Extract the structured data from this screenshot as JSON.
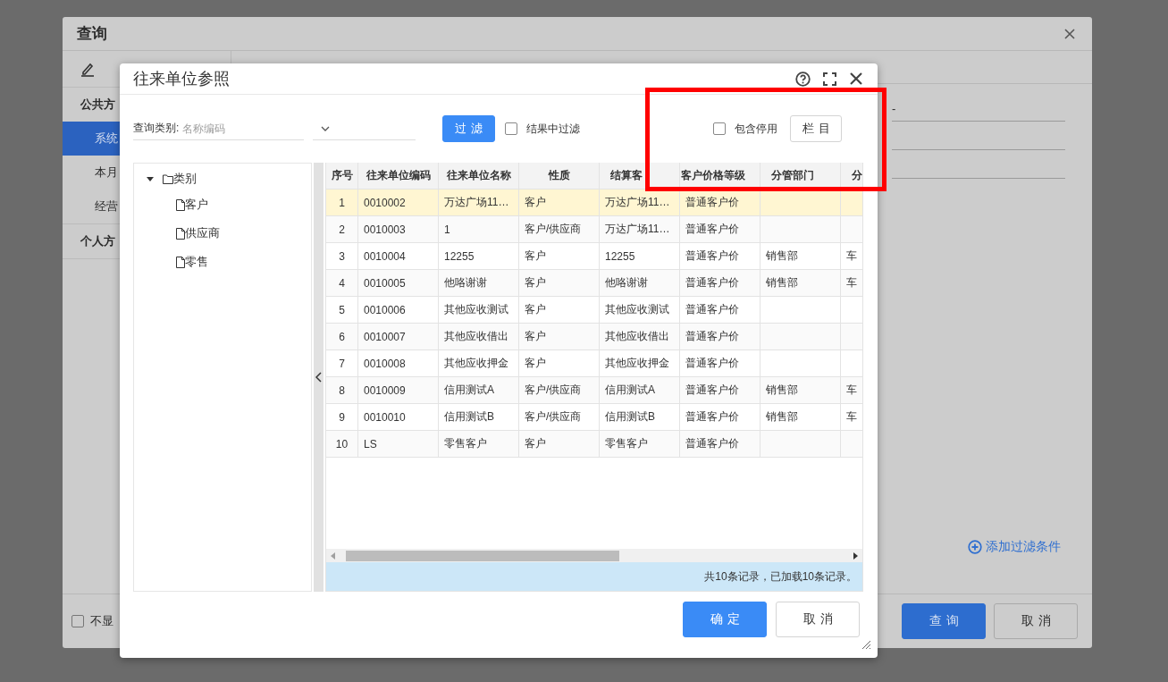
{
  "background_dialog": {
    "title": "查询",
    "sidebar": {
      "sections": [
        {
          "title": "公共方",
          "items": [
            {
              "label": "系统",
              "selected": true
            },
            {
              "label": "本月",
              "selected": false
            },
            {
              "label": "经营",
              "selected": false
            }
          ]
        },
        {
          "title": "个人方"
        }
      ]
    },
    "conditions": {
      "separator": "-"
    },
    "add_filter": "添加过滤条件",
    "dont_show": {
      "label": "不显",
      "checked": false
    },
    "buttons": [
      {
        "label": "查询",
        "kind": "primary"
      },
      {
        "label": "取消",
        "kind": "default"
      }
    ]
  },
  "dialog": {
    "title": "往来单位参照",
    "query_type": {
      "label": "查询类别:",
      "placeholder": "名称编码"
    },
    "filter_button": "过滤",
    "filter_in_results": {
      "label": "结果中过滤",
      "checked": false
    },
    "include_disabled": {
      "label": "包含停用",
      "checked": false
    },
    "columns_button": "栏目",
    "tree": {
      "label": "类别",
      "expanded": true,
      "children": [
        {
          "label": "客户"
        },
        {
          "label": "供应商"
        },
        {
          "label": "零售"
        }
      ]
    },
    "table": {
      "columns": [
        "序号",
        "往来单位编码",
        "往来单位名称",
        "性质",
        "结算客",
        "客户价格等级",
        "分管部门",
        "分"
      ],
      "rows": [
        {
          "cells": [
            "1",
            "0010002",
            "万达广场11…",
            "客户",
            "万达广场11…",
            "普通客户价",
            "",
            ""
          ],
          "selected": true
        },
        {
          "cells": [
            "2",
            "0010003",
            "1",
            "客户/供应商",
            "万达广场11…",
            "普通客户价",
            "",
            ""
          ],
          "selected": false
        },
        {
          "cells": [
            "3",
            "0010004",
            "12255",
            "客户",
            "12255",
            "普通客户价",
            "销售部",
            "车"
          ],
          "selected": false
        },
        {
          "cells": [
            "4",
            "0010005",
            "他咯谢谢",
            "客户",
            "他咯谢谢",
            "普通客户价",
            "销售部",
            "车"
          ],
          "selected": false
        },
        {
          "cells": [
            "5",
            "0010006",
            "其他应收测试",
            "客户",
            "其他应收测试",
            "普通客户价",
            "",
            ""
          ],
          "selected": false
        },
        {
          "cells": [
            "6",
            "0010007",
            "其他应收借出",
            "客户",
            "其他应收借出",
            "普通客户价",
            "",
            ""
          ],
          "selected": false
        },
        {
          "cells": [
            "7",
            "0010008",
            "其他应收押金",
            "客户",
            "其他应收押金",
            "普通客户价",
            "",
            ""
          ],
          "selected": false
        },
        {
          "cells": [
            "8",
            "0010009",
            "信用测试A",
            "客户/供应商",
            "信用测试A",
            "普通客户价",
            "销售部",
            "车"
          ],
          "selected": false
        },
        {
          "cells": [
            "9",
            "0010010",
            "信用测试B",
            "客户/供应商",
            "信用测试B",
            "普通客户价",
            "销售部",
            "车"
          ],
          "selected": false
        },
        {
          "cells": [
            "10",
            "LS",
            "零售客户",
            "客户",
            "零售客户",
            "普通客户价",
            "",
            ""
          ],
          "selected": false
        }
      ]
    },
    "status": "共10条记录，已加载10条记录。",
    "buttons": [
      {
        "label": "确定",
        "kind": "primary"
      },
      {
        "label": "取消",
        "kind": "default"
      }
    ]
  },
  "annotation": {
    "kind": "rectangle"
  }
}
